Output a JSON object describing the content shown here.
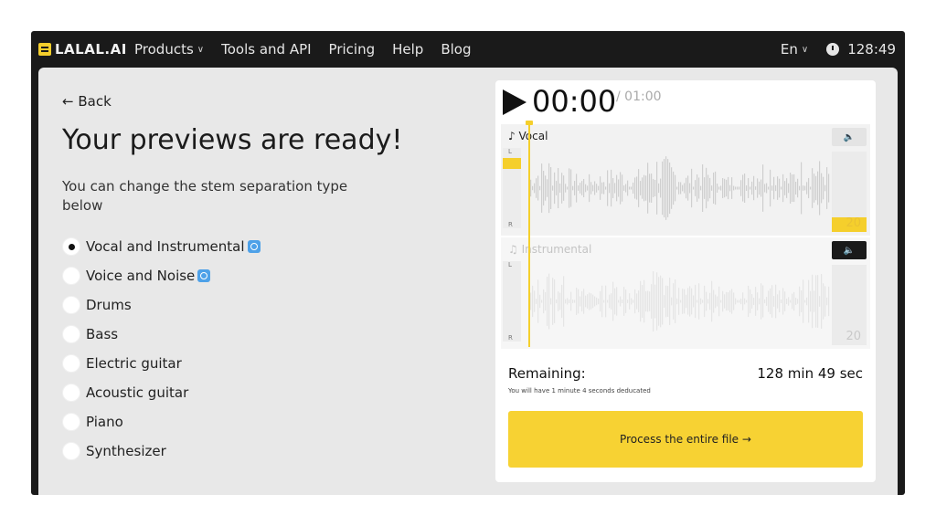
{
  "header": {
    "logo": "LALAL.AI",
    "nav": [
      {
        "label": "Products",
        "dropdown": true
      },
      {
        "label": "Tools and API"
      },
      {
        "label": "Pricing"
      },
      {
        "label": "Help"
      },
      {
        "label": "Blog"
      }
    ],
    "language": "En",
    "time_remaining": "128:49"
  },
  "left": {
    "back": "← Back",
    "title": "Your previews are ready!",
    "subtitle": "You can change the stem separation type below",
    "options": [
      {
        "label": "Vocal and Instrumental",
        "selected": true,
        "badge": true
      },
      {
        "label": "Voice and Noise",
        "selected": false,
        "badge": true
      },
      {
        "label": "Drums",
        "selected": false
      },
      {
        "label": "Bass",
        "selected": false
      },
      {
        "label": "Electric guitar",
        "selected": false
      },
      {
        "label": "Acoustic guitar",
        "selected": false
      },
      {
        "label": "Piano",
        "selected": false
      },
      {
        "label": "Synthesizer",
        "selected": false
      }
    ]
  },
  "player": {
    "current_time": "00:00",
    "total_time": "/ 01:00",
    "tracks": [
      {
        "label": "Vocal",
        "icon": "vocal-icon",
        "lr_left": "L",
        "lr_right": "R",
        "volume": "20",
        "muted": false
      },
      {
        "label": "Instrumental",
        "icon": "music-note-icon",
        "lr_left": "L",
        "lr_right": "R",
        "volume": "20",
        "muted": true
      }
    ],
    "speaker_symbol": "🔈"
  },
  "summary": {
    "remaining_label": "Remaining:",
    "remaining_value": "128 min 49 sec",
    "deduct_note": "You will have 1 minute 4 seconds deducated",
    "process_label": "Process the entire file →"
  },
  "colors": {
    "accent": "#f5cf2c",
    "dark": "#1a1a1a",
    "panel": "#e8e8e8"
  }
}
